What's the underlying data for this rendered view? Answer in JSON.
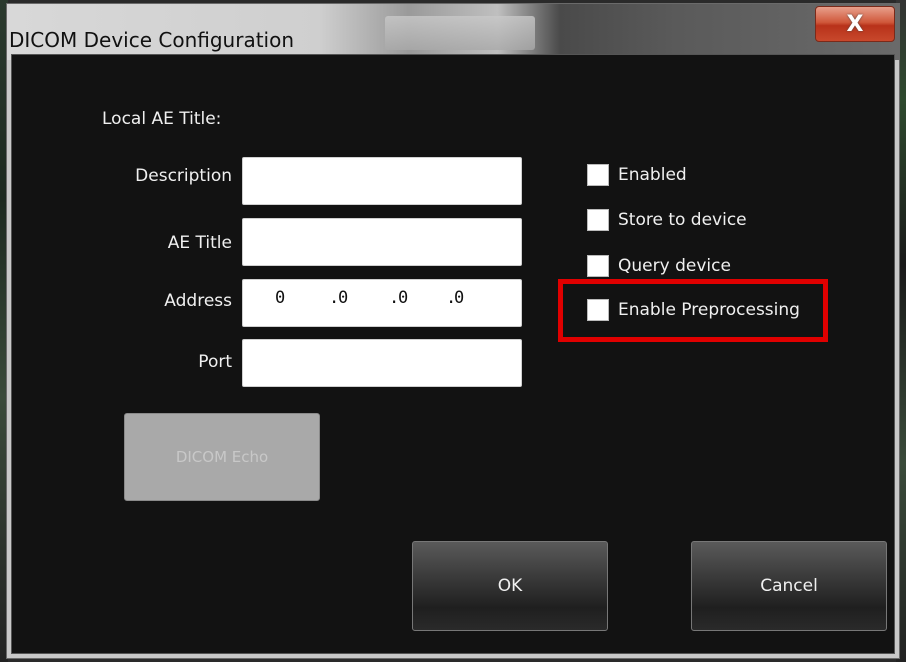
{
  "window": {
    "title": "DICOM Device Configuration",
    "close_label": "X"
  },
  "form": {
    "local_ae_title_label": "Local AE Title:",
    "description_label": "Description",
    "description_value": "",
    "ae_title_label": "AE Title",
    "ae_title_value": "",
    "address_label": "Address",
    "address_octets": [
      "0",
      "0",
      "0",
      "0"
    ],
    "address_separator": ".",
    "port_label": "Port",
    "port_value": ""
  },
  "options": {
    "enabled_label": "Enabled",
    "enabled_checked": false,
    "store_label": "Store to device",
    "store_checked": false,
    "query_label": "Query device",
    "query_checked": false,
    "preprocessing_label": "Enable Preprocessing",
    "preprocessing_checked": false
  },
  "buttons": {
    "echo_label": "DICOM Echo",
    "ok_label": "OK",
    "cancel_label": "Cancel"
  },
  "colors": {
    "highlight": "#e00000",
    "close_button": "#c8482c",
    "client_background": "#121212"
  }
}
